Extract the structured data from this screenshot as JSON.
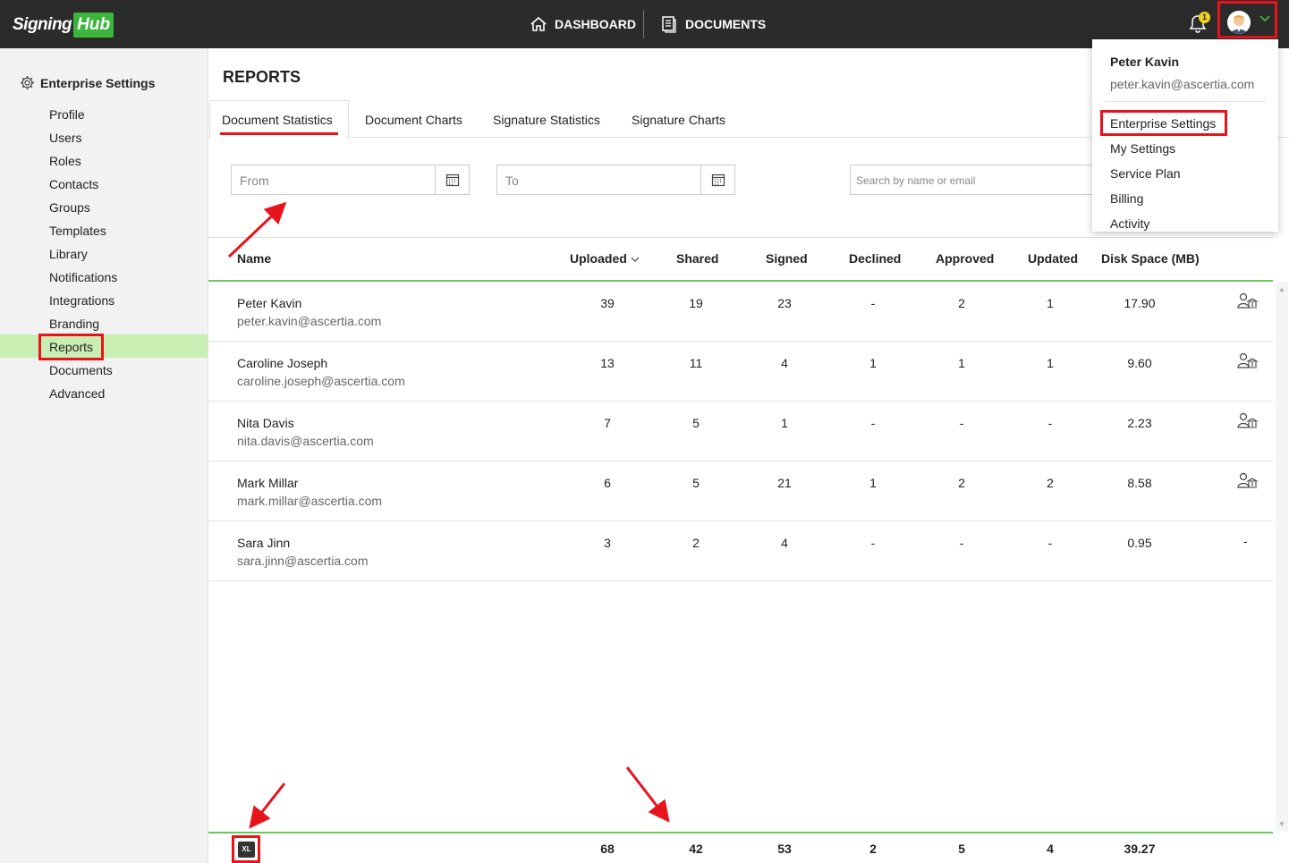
{
  "header": {
    "logo_text": "Signing",
    "logo_hub": "Hub",
    "nav_dashboard": "DASHBOARD",
    "nav_documents": "DOCUMENTS",
    "notification_count": "1",
    "accent_color": "#3cb53c",
    "highlight_color": "#e8141b"
  },
  "sidebar": {
    "title": "Enterprise Settings",
    "items": [
      "Profile",
      "Users",
      "Roles",
      "Contacts",
      "Groups",
      "Templates",
      "Library",
      "Notifications",
      "Integrations",
      "Branding",
      "Reports",
      "Documents",
      "Advanced"
    ],
    "active": "Reports"
  },
  "main": {
    "title": "REPORTS",
    "tabs": [
      "Document Statistics",
      "Document Charts",
      "Signature Statistics",
      "Signature Charts"
    ],
    "active_tab": "Document Statistics",
    "from_placeholder": "From",
    "to_placeholder": "To",
    "search_placeholder": "Search by name or email"
  },
  "table": {
    "headers": [
      "Name",
      "Uploaded",
      "Shared",
      "Signed",
      "Declined",
      "Approved",
      "Updated",
      "Disk Space (MB)"
    ],
    "sort_column": "Uploaded",
    "rows": [
      {
        "name": "Peter Kavin",
        "email": "peter.kavin@ascertia.com",
        "uploaded": "39",
        "shared": "19",
        "signed": "23",
        "declined": "-",
        "approved": "2",
        "updated": "1",
        "disk": "17.90",
        "action": "user-admin-icon"
      },
      {
        "name": "Caroline Joseph",
        "email": "caroline.joseph@ascertia.com",
        "uploaded": "13",
        "shared": "11",
        "signed": "4",
        "declined": "1",
        "approved": "1",
        "updated": "1",
        "disk": "9.60",
        "action": "user-admin-icon"
      },
      {
        "name": "Nita Davis",
        "email": "nita.davis@ascertia.com",
        "uploaded": "7",
        "shared": "5",
        "signed": "1",
        "declined": "-",
        "approved": "-",
        "updated": "-",
        "disk": "2.23",
        "action": "user-admin-icon"
      },
      {
        "name": "Mark Millar",
        "email": "mark.millar@ascertia.com",
        "uploaded": "6",
        "shared": "5",
        "signed": "21",
        "declined": "1",
        "approved": "2",
        "updated": "2",
        "disk": "8.58",
        "action": "user-admin-icon"
      },
      {
        "name": "Sara Jinn",
        "email": "sara.jinn@ascertia.com",
        "uploaded": "3",
        "shared": "2",
        "signed": "4",
        "declined": "-",
        "approved": "-",
        "updated": "-",
        "disk": "0.95",
        "action": "-"
      }
    ],
    "totals": {
      "export_label": "XL",
      "uploaded": "68",
      "shared": "42",
      "signed": "53",
      "declined": "2",
      "approved": "5",
      "updated": "4",
      "disk": "39.27"
    }
  },
  "user_menu": {
    "name": "Peter Kavin",
    "email": "peter.kavin@ascertia.com",
    "items": [
      "Enterprise Settings",
      "My Settings",
      "Service Plan",
      "Billing",
      "Activity"
    ]
  }
}
